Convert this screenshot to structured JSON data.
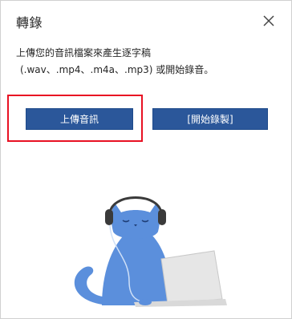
{
  "header": {
    "title": "轉錄",
    "close_icon": "close-icon"
  },
  "description": {
    "line1": "上傳您的音訊檔案來產生逐字稿",
    "line2": "(.wav、.mp4、.m4a、.mp3) 或開始錄音。"
  },
  "actions": {
    "upload_label": "上傳音訊",
    "record_label": "[開始錄製]"
  },
  "colors": {
    "button_bg": "#2b579a",
    "focus_ring": "#e81123",
    "cat": "#5b8fdc"
  },
  "illustration": {
    "icon": "cat-with-headphones-laptop-illustration"
  }
}
